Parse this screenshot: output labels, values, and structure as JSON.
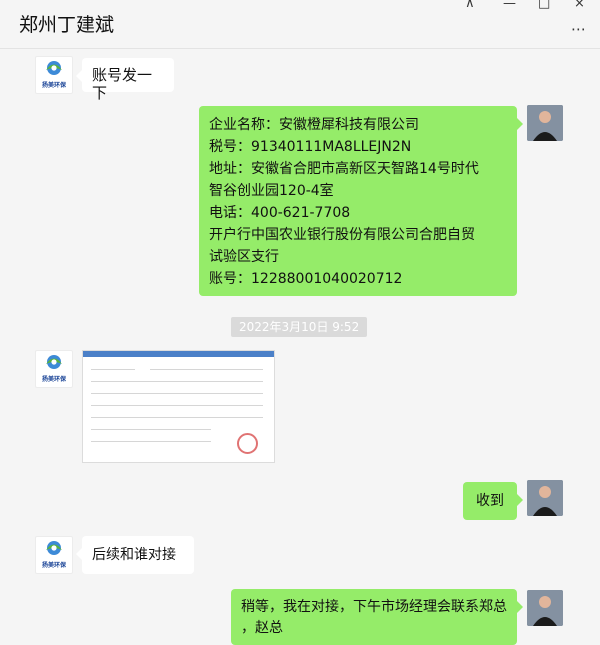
{
  "window": {
    "title": "郑州丁建斌",
    "controls": {
      "pin": "⊼",
      "minimize": "—",
      "maximize": "□",
      "close": "×"
    }
  },
  "avatars": {
    "left_logo_text": "扬美环保"
  },
  "messages": [
    {
      "side": "left",
      "text": "账号发一下"
    },
    {
      "side": "right",
      "lines": [
        "企业名称：安徽橙犀科技有限公司",
        "税号：91340111MA8LLEJN2N",
        "地址：安徽省合肥市高新区天智路14号时代",
        "智谷创业园120-4室",
        "电话：400-621-7708",
        "开户行中国农业银行股份有限公司合肥自贸",
        "试验区支行",
        "账号：12288001040020712"
      ]
    },
    {
      "side": "center",
      "timestamp": "2022年3月10日 9:52"
    },
    {
      "side": "left",
      "type": "image"
    },
    {
      "side": "right",
      "text": "收到"
    },
    {
      "side": "left",
      "text": "后续和谁对接"
    },
    {
      "side": "right",
      "lines": [
        "稍等，我在对接，下午市场经理会联系郑总",
        "，赵总"
      ]
    }
  ],
  "colors": {
    "window_bg": "#f5f5f5",
    "incoming_bubble": "#ffffff",
    "outgoing_bubble": "#95ec69",
    "timestamp_bg": "#dadada"
  }
}
